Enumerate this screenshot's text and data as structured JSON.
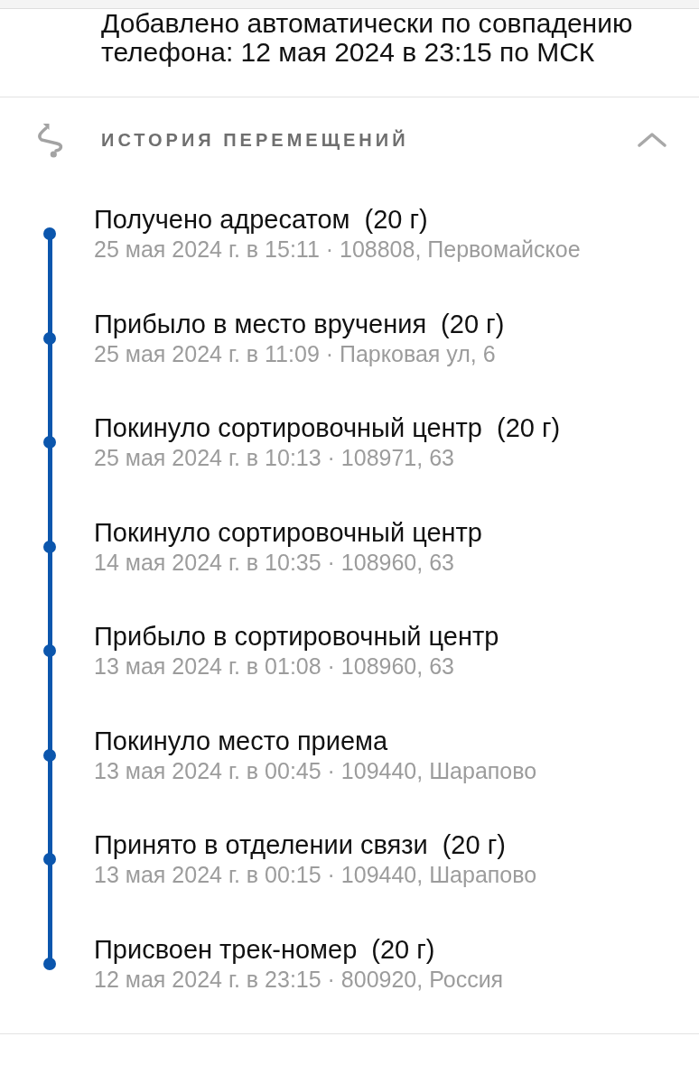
{
  "top_note": {
    "text": "Добавлено автоматически по совпадению телефона: 12 мая 2024 в 23:15 по МСК"
  },
  "history": {
    "title": "ИСТОРИЯ ПЕРЕМЕЩЕНИЙ",
    "expanded": true,
    "events": [
      {
        "title": "Получено адресатом",
        "weight": "(20 г)",
        "details": "25 мая 2024 г. в 15:11 · 108808, Первомайское"
      },
      {
        "title": "Прибыло в место вручения",
        "weight": "(20 г)",
        "details": "25 мая 2024 г. в 11:09 · Парковая ул, 6"
      },
      {
        "title": "Покинуло сортировочный центр",
        "weight": "(20 г)",
        "details": "25 мая 2024 г. в 10:13 · 108971, 63"
      },
      {
        "title": "Покинуло сортировочный центр",
        "details": "14 мая 2024 г. в 10:35 · 108960, 63"
      },
      {
        "title": "Прибыло в сортировочный центр",
        "details": "13 мая 2024 г. в 01:08 · 108960, 63"
      },
      {
        "title": "Покинуло место приема",
        "details": "13 мая 2024 г. в 00:45 · 109440, Шарапово"
      },
      {
        "title": "Принято в отделении связи",
        "weight": "(20 г)",
        "details": "13 мая 2024 г. в 00:15 · 109440, Шарапово"
      },
      {
        "title": "Присвоен трек-номер",
        "weight": "(20 г)",
        "details": "12 мая 2024 г. в 23:15 · 800920, Россия"
      }
    ]
  }
}
